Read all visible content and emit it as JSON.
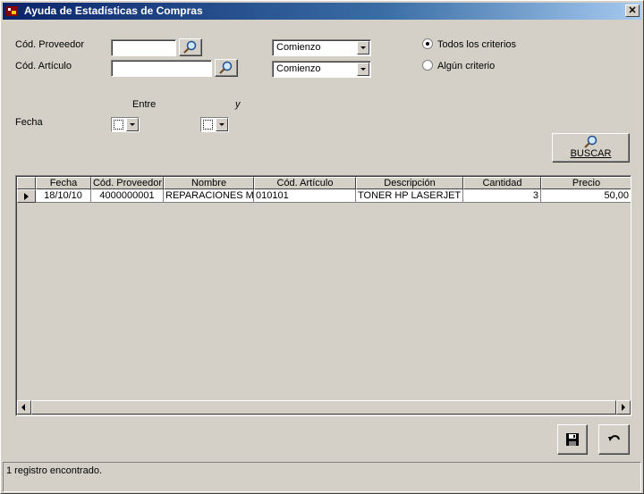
{
  "window": {
    "title": "Ayuda de Estadísticas de Compras",
    "close_label": "✕"
  },
  "filters": {
    "proveedor_label": "Cód. Proveedor",
    "proveedor_value": "",
    "articulo_label": "Cód. Artículo",
    "articulo_value": "",
    "proveedor_match": "Comienzo",
    "articulo_match": "Comienzo",
    "fecha_label": "Fecha",
    "entre_label": "Entre",
    "y_label": "y"
  },
  "criteria": {
    "options": [
      "Todos los criterios",
      "Algún criterio"
    ],
    "selected": "Todos los criterios"
  },
  "search_button": {
    "label": "BUSCAR"
  },
  "grid": {
    "columns": [
      "Fecha",
      "Cód. Proveedor",
      "Nombre",
      "Cód. Artículo",
      "Descripción",
      "Cantidad",
      "Precio"
    ],
    "rows": [
      {
        "fecha": "18/10/10",
        "cod_proveedor": "4000000001",
        "nombre": "REPARACIONES M",
        "cod_articulo": "010101",
        "descripcion": "TONER HP LASERJET",
        "cantidad": "3",
        "precio": "50,00"
      }
    ]
  },
  "icons": {
    "app": "app-icon",
    "search": "magnifier-icon",
    "save": "floppy-disk-icon",
    "undo": "undo-arrow-icon"
  },
  "status": {
    "text": "1 registro encontrado."
  },
  "colors": {
    "titlebar_start": "#0a246a",
    "titlebar_end": "#a6caf0",
    "face": "#d4d0c8"
  }
}
